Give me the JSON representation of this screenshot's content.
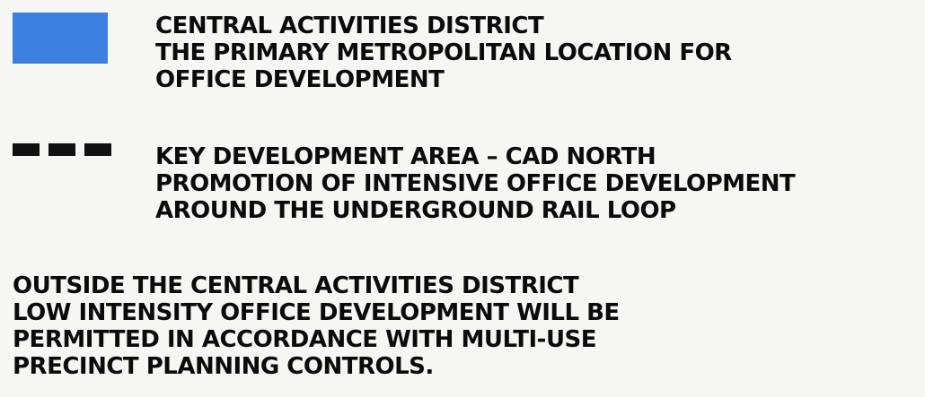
{
  "legend": {
    "cad": {
      "color": "#3b7fe0",
      "lines": [
        "CENTRAL ACTIVITIES DISTRICT",
        "THE PRIMARY METROPOLITAN LOCATION FOR",
        "OFFICE DEVELOPMENT"
      ]
    },
    "key_area": {
      "symbol": "dashed-line",
      "lines": [
        "KEY DEVELOPMENT AREA – CAD NORTH",
        "PROMOTION OF INTENSIVE OFFICE DEVELOPMENT",
        "AROUND THE UNDERGROUND RAIL LOOP"
      ]
    },
    "outside": {
      "lines": [
        "OUTSIDE THE CENTRAL ACTIVITIES DISTRICT",
        "LOW INTENSITY OFFICE DEVELOPMENT WILL BE",
        "PERMITTED IN ACCORDANCE WITH MULTI-USE",
        "PRECINCT PLANNING CONTROLS."
      ]
    }
  }
}
